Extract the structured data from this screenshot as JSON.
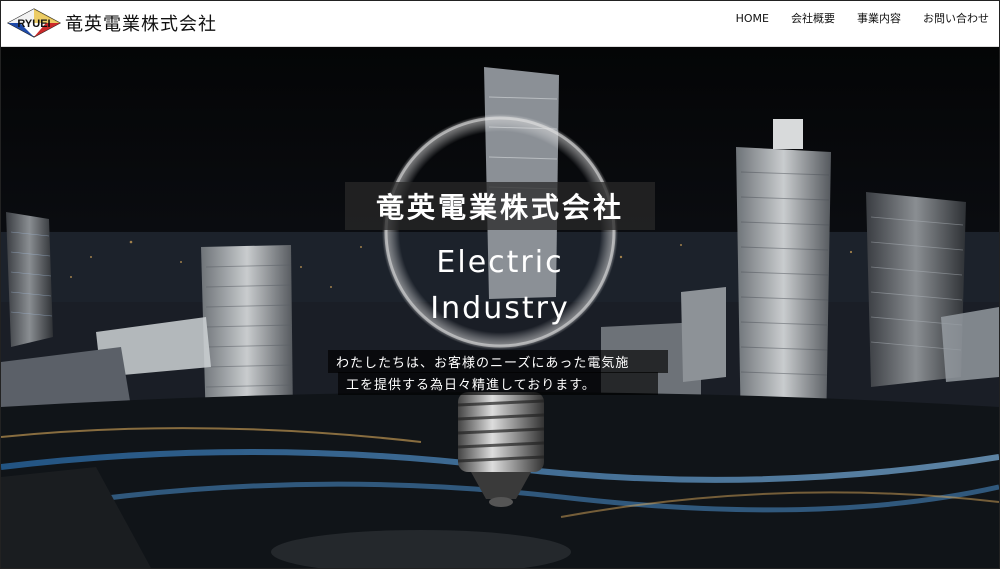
{
  "site": {
    "logo_text": "RYUEI",
    "company_name": "竜英電業株式会社"
  },
  "nav": {
    "items": [
      {
        "label": "HOME"
      },
      {
        "label": "会社概要"
      },
      {
        "label": "事業内容"
      },
      {
        "label": "お問い合わせ"
      }
    ]
  },
  "hero": {
    "title": "竜英電業株式会社",
    "subtitle_line1": "Electric",
    "subtitle_line2": "Industry",
    "description_line1": "わたしたちは、お客様のニーズにあった電気施",
    "description_line2": "工を提供する為日々精進しております。"
  },
  "colors": {
    "logo_red": "#cc2a2a",
    "logo_blue": "#1f4aa8",
    "header_bg": "#ffffff"
  }
}
